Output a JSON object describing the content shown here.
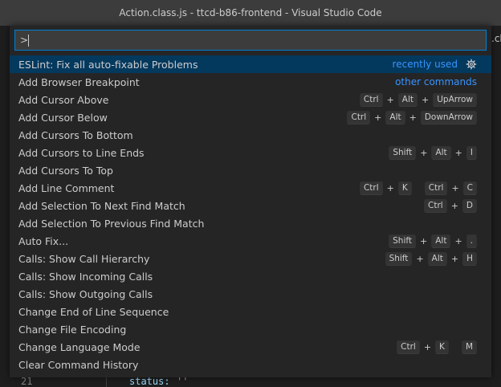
{
  "window": {
    "title": "Action.class.js - ttcd-b86-frontend - Visual Studio Code"
  },
  "editor": {
    "peek_text": ".cla",
    "line_number": "21",
    "code_key": "status:",
    "code_value": "''"
  },
  "quickpick": {
    "input_value": ">",
    "items": [
      {
        "label": "ESLint: Fix all auto-fixable Problems",
        "tag": "recently used",
        "gear": true,
        "keys": []
      },
      {
        "label": "Add Browser Breakpoint",
        "tag": "other commands",
        "keys": []
      },
      {
        "label": "Add Cursor Above",
        "keys": [
          [
            "Ctrl",
            "Alt",
            "UpArrow"
          ]
        ]
      },
      {
        "label": "Add Cursor Below",
        "keys": [
          [
            "Ctrl",
            "Alt",
            "DownArrow"
          ]
        ]
      },
      {
        "label": "Add Cursors To Bottom",
        "keys": []
      },
      {
        "label": "Add Cursors to Line Ends",
        "keys": [
          [
            "Shift",
            "Alt",
            "I"
          ]
        ]
      },
      {
        "label": "Add Cursors To Top",
        "keys": []
      },
      {
        "label": "Add Line Comment",
        "keys": [
          [
            "Ctrl",
            "K"
          ],
          [
            "Ctrl",
            "C"
          ]
        ]
      },
      {
        "label": "Add Selection To Next Find Match",
        "keys": [
          [
            "Ctrl",
            "D"
          ]
        ]
      },
      {
        "label": "Add Selection To Previous Find Match",
        "keys": []
      },
      {
        "label": "Auto Fix...",
        "keys": [
          [
            "Shift",
            "Alt",
            "."
          ]
        ]
      },
      {
        "label": "Calls: Show Call Hierarchy",
        "keys": [
          [
            "Shift",
            "Alt",
            "H"
          ]
        ]
      },
      {
        "label": "Calls: Show Incoming Calls",
        "keys": []
      },
      {
        "label": "Calls: Show Outgoing Calls",
        "keys": []
      },
      {
        "label": "Change End of Line Sequence",
        "keys": []
      },
      {
        "label": "Change File Encoding",
        "keys": []
      },
      {
        "label": "Change Language Mode",
        "keys": [
          [
            "Ctrl",
            "K"
          ],
          [
            "M"
          ]
        ]
      },
      {
        "label": "Clear Command History",
        "keys": []
      }
    ]
  },
  "colors": {
    "accent": "#007fd4",
    "selection": "#04395e",
    "tag": "#3794ff"
  }
}
